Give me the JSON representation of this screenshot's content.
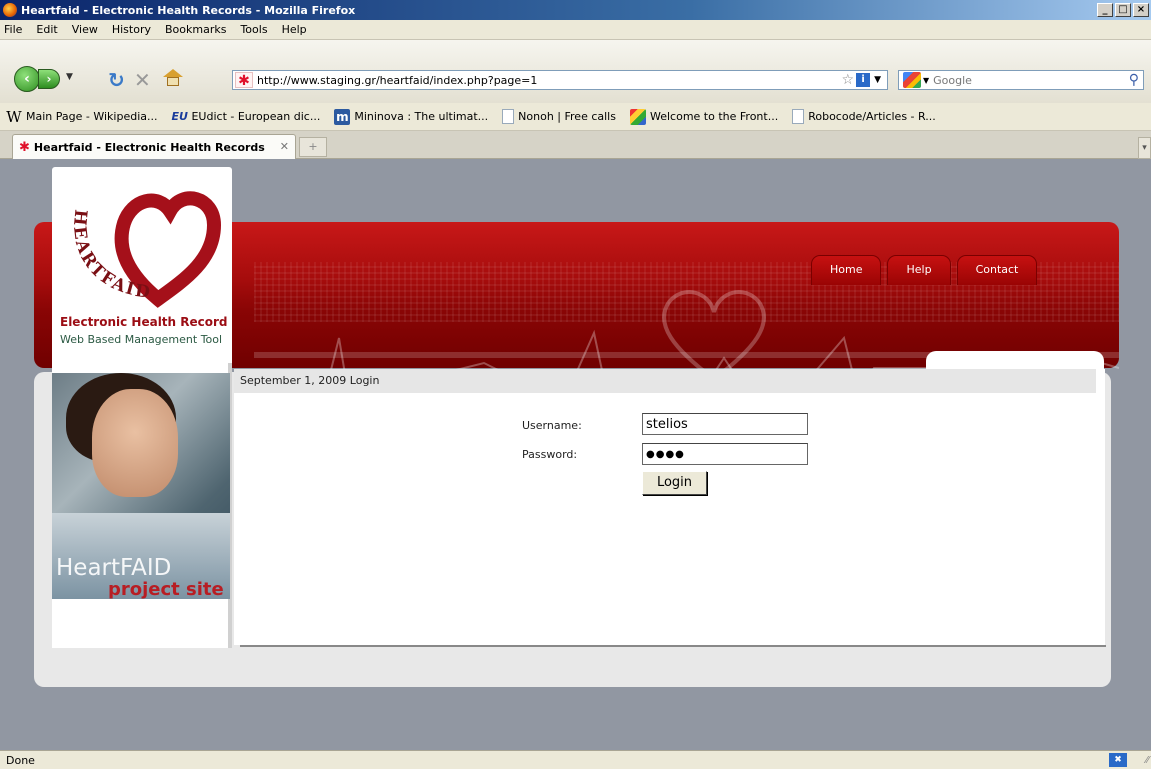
{
  "window": {
    "title": "Heartfaid - Electronic Health Records - Mozilla Firefox",
    "controls": [
      "_",
      "□",
      "×"
    ]
  },
  "menu": [
    "File",
    "Edit",
    "View",
    "History",
    "Bookmarks",
    "Tools",
    "Help"
  ],
  "toolbar": {
    "url": "http://www.staging.gr/heartfaid/index.php?page=1",
    "search_placeholder": "Google"
  },
  "bookmarks": [
    {
      "label": "Main Page - Wikipedia...",
      "icon": "wikipedia-icon"
    },
    {
      "label": "EUdict - European dic...",
      "icon": "eudict-icon"
    },
    {
      "label": "Mininova : The ultimat...",
      "icon": "mininova-icon"
    },
    {
      "label": "Nonoh | Free calls",
      "icon": "page-icon"
    },
    {
      "label": "Welcome to the Front...",
      "icon": "frontpage-icon"
    },
    {
      "label": "Robocode/Articles - R...",
      "icon": "page-icon"
    }
  ],
  "tabs": [
    {
      "label": "Heartfaid - Electronic Health Records",
      "active": true
    }
  ],
  "site": {
    "nav": [
      "Home",
      "Help",
      "Contact"
    ],
    "logo": {
      "text_arc": "HEARTFAID",
      "line1": "Electronic Health Record",
      "line2": "Web Based Management Tool"
    },
    "photo": {
      "line1": "HeartFAID",
      "line2": "project site"
    },
    "breadcrumb": "September 1, 2009  Login",
    "form": {
      "username_label": "Username:",
      "username_value": "stelios",
      "password_label": "Password:",
      "password_value": "●●●●",
      "login_label": "Login"
    }
  },
  "status": {
    "text": "Done"
  },
  "colors": {
    "brand_red": "#a50c0c",
    "page_bg": "#9197a2"
  }
}
